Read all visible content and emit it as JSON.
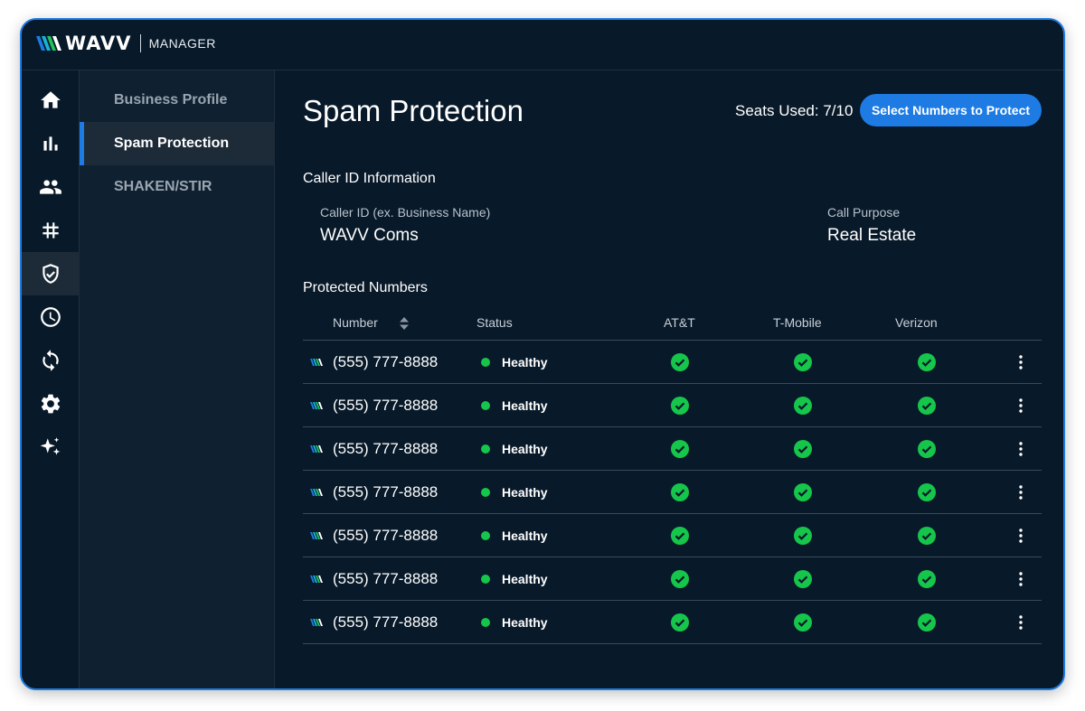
{
  "app": {
    "logo_text": "WAVV",
    "logo_sub": "MANAGER"
  },
  "rail": {
    "icons": [
      "home-icon",
      "bar-chart-icon",
      "people-icon",
      "hashtag-icon",
      "shield-check-icon",
      "clock-icon",
      "sync-icon",
      "gear-icon",
      "sparkle-icon"
    ],
    "active": "shield-check-icon"
  },
  "subnav": {
    "items": [
      {
        "label": "Business Profile"
      },
      {
        "label": "Spam Protection"
      },
      {
        "label": "SHAKEN/STIR"
      }
    ],
    "active": "Spam Protection"
  },
  "header": {
    "title": "Spam Protection",
    "seats_used": "Seats Used: 7/10",
    "action_label": "Select Numbers to Protect"
  },
  "caller_id": {
    "section_title": "Caller ID Information",
    "caller_label": "Caller ID (ex. Business Name)",
    "caller_value": "WAVV Coms",
    "purpose_label": "Call Purpose",
    "purpose_value": "Real Estate"
  },
  "protected": {
    "section_title": "Protected Numbers",
    "columns": [
      "Number",
      "Status",
      "AT&T",
      "T-Mobile",
      "Verizon"
    ],
    "rows": [
      {
        "number": "(555) 777-8888",
        "status": "Healthy"
      },
      {
        "number": "(555) 777-8888",
        "status": "Healthy"
      },
      {
        "number": "(555) 777-8888",
        "status": "Healthy"
      },
      {
        "number": "(555) 777-8888",
        "status": "Healthy"
      },
      {
        "number": "(555) 777-8888",
        "status": "Healthy"
      },
      {
        "number": "(555) 777-8888",
        "status": "Healthy"
      },
      {
        "number": "(555) 777-8888",
        "status": "Healthy"
      }
    ]
  },
  "colors": {
    "background": "#081929",
    "accent": "#1d7be3",
    "healthy": "#15c64b"
  }
}
